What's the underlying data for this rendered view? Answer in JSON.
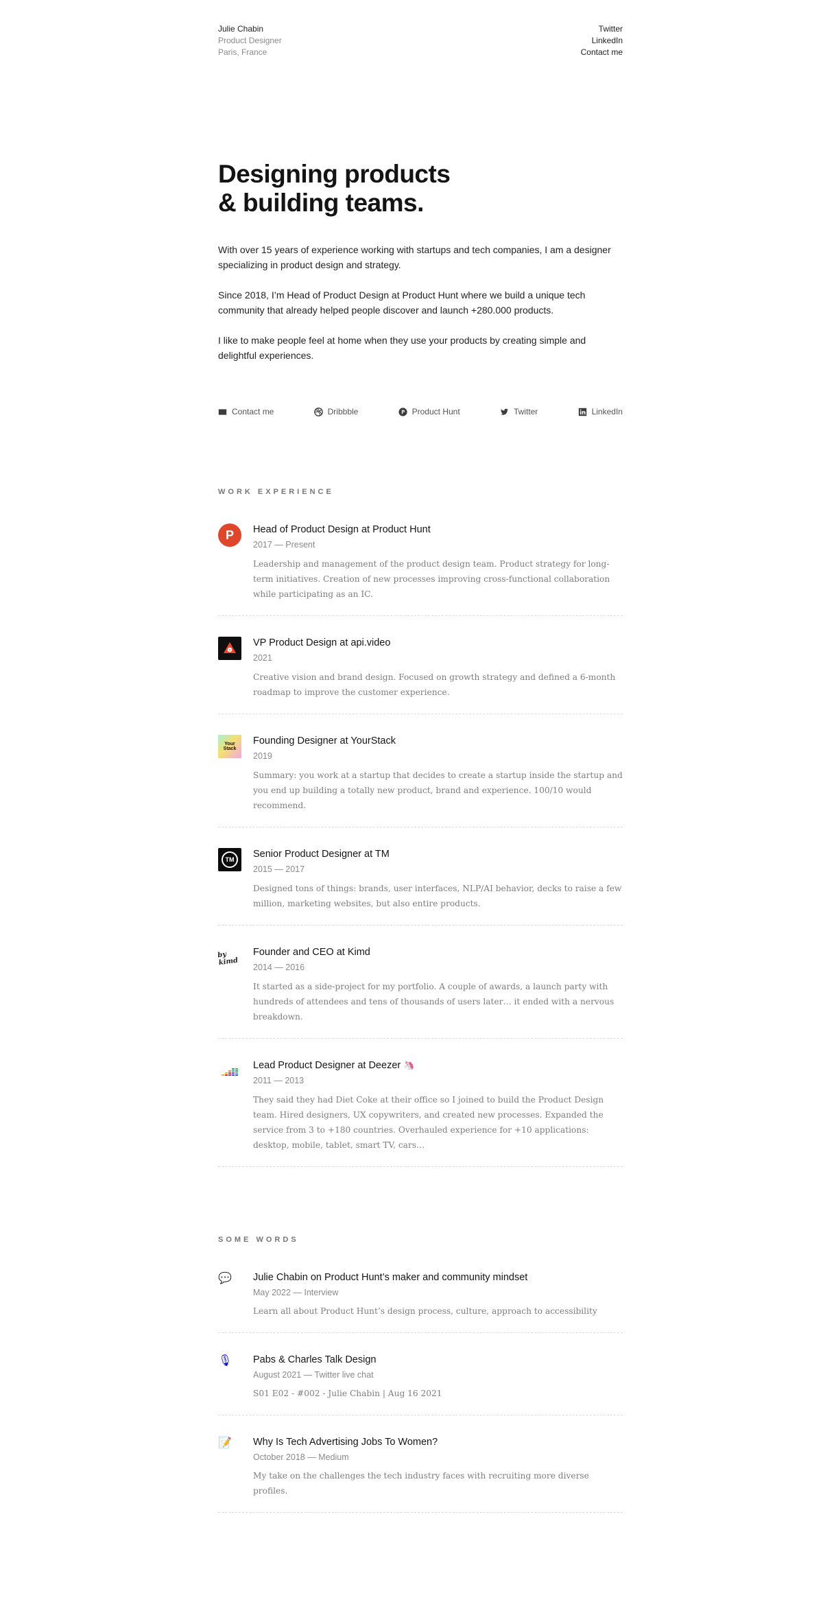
{
  "header": {
    "name": "Julie Chabin",
    "role": "Product Designer",
    "location": "Paris, France",
    "links": [
      "Twitter",
      "LinkedIn",
      "Contact me"
    ]
  },
  "hero": {
    "title_line1": "Designing products",
    "title_line2": "& building teams.",
    "paragraphs": [
      "With over 15 years of experience working with startups and tech companies, I am a designer specializing in product design and strategy.",
      "Since 2018, I’m Head of Product Design at Product Hunt where we build a unique tech community that already helped people discover and launch +280.000 products.",
      "I like to make people feel at home when they use your products by creating simple and delightful experiences."
    ]
  },
  "social": [
    {
      "label": "Contact me",
      "icon": "mail-icon"
    },
    {
      "label": "Dribbble",
      "icon": "dribbble-icon"
    },
    {
      "label": "Product Hunt",
      "icon": "producthunt-icon"
    },
    {
      "label": "Twitter",
      "icon": "twitter-icon"
    },
    {
      "label": "LinkedIn",
      "icon": "linkedin-icon"
    }
  ],
  "work": {
    "title": "WORK EXPERIENCE",
    "items": [
      {
        "title": "Head of Product Design at Product Hunt",
        "date": "2017 — Present",
        "desc": "Leadership and management of the product design team. Product strategy for long-term initiatives. Creation of new processes improving cross-functional collaboration while participating as an IC.",
        "logo": "producthunt-logo",
        "logo_text": "P"
      },
      {
        "title": "VP Product Design at api.video",
        "date": "2021",
        "desc": "Creative vision and brand design. Focused on growth strategy and defined a 6-month roadmap to improve the customer experience.",
        "logo": "apivideo-logo"
      },
      {
        "title": "Founding Designer at YourStack",
        "date": "2019",
        "desc": "Summary: you work at a startup that decides to create a startup inside the startup and you end up building a totally new product, brand and experience. 100/10 would recommend.",
        "logo": "yourstack-logo",
        "logo_text": "Your Stack"
      },
      {
        "title": "Senior Product Designer at TM",
        "date": "2015 — 2017",
        "desc": "Designed tons of things: brands, user interfaces, NLP/AI behavior, decks to raise a few million, marketing websites, but also entire products.",
        "logo": "tm-logo",
        "logo_text": "TM"
      },
      {
        "title": "Founder and CEO at Kimd",
        "date": "2014 — 2016",
        "desc": "It started as a side-project for my portfolio. A couple of awards, a launch party with hundreds of attendees and tens of thousands of users later… it ended with a nervous breakdown.",
        "logo": "kimd-logo",
        "logo_text": "by kimd"
      },
      {
        "title": "Lead Product Designer at Deezer",
        "title_emoji": "🦄",
        "date": "2011 — 2013",
        "desc": "They said they had Diet Coke at their office so I joined to build the Product Design team. Hired designers, UX copywriters, and created new processes. Expanded the service from 3 to +180 countries. Overhauled experience for +10 applications: desktop, mobile, tablet, smart TV, cars…",
        "logo": "deezer-logo"
      }
    ]
  },
  "words": {
    "title": "SOME WORDS",
    "items": [
      {
        "title": "Julie Chabin on Product Hunt’s maker and community mindset",
        "date": "May 2022 — Interview",
        "desc": "Learn all about Product Hunt’s design process, culture, approach to accessibility",
        "emoji": "💬"
      },
      {
        "title": "Pabs & Charles Talk Design",
        "date": "August 2021 — Twitter live chat",
        "desc": "S01 E02 - #002 - Julie Chabin | Aug 16 2021",
        "emoji": "🎙"
      },
      {
        "title": "Why Is Tech Advertising Jobs To Women?",
        "date": "October 2018 — Medium",
        "desc": "My take on the challenges the tech industry faces with recruiting more diverse profiles.",
        "emoji": "📝"
      }
    ]
  },
  "colors": {
    "producthunt": "#e0462a",
    "text": "#1a1a1a",
    "muted": "#8a8a8a"
  }
}
